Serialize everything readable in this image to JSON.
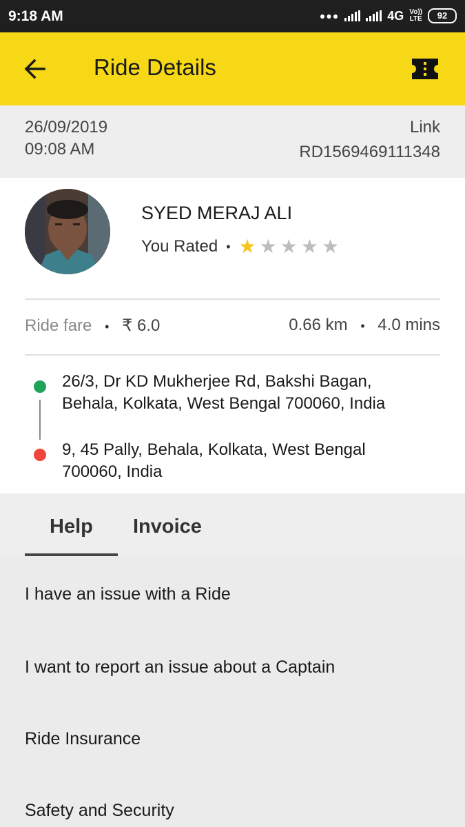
{
  "status_bar": {
    "time": "9:18 AM",
    "network": "4G",
    "volte_line1": "Vo))",
    "volte_line2": "LTE",
    "battery": "92"
  },
  "app_bar": {
    "title": "Ride Details",
    "back_icon": "arrow-left-icon",
    "action_icon": "ticket-icon",
    "background": "#f6d817"
  },
  "ride_meta": {
    "date": "26/09/2019",
    "time": "09:08 AM",
    "link_label": "Link",
    "ride_id": "RD1569469111348"
  },
  "driver": {
    "name": "SYED MERAJ ALI",
    "rated_label": "You Rated",
    "rating": 1,
    "rating_max": 5
  },
  "fare": {
    "label": "Ride fare",
    "amount": "₹ 6.0",
    "distance": "0.66 km",
    "duration": "4.0 mins"
  },
  "route": {
    "pickup_line1": "26/3, Dr KD Mukherjee Rd, Bakshi Bagan,",
    "pickup_line2": "Behala, Kolkata, West Bengal 700060, India",
    "drop_line1": "9, 45 Pally, Behala, Kolkata, West Bengal",
    "drop_line2": "700060, India",
    "pickup_color": "#21a259",
    "drop_color": "#f2453b"
  },
  "tabs": [
    {
      "label": "Help",
      "active": true
    },
    {
      "label": "Invoice",
      "active": false
    }
  ],
  "help_items": [
    "I have an issue with a Ride",
    "I want to report an issue about a Captain",
    "Ride Insurance",
    "Safety and Security"
  ]
}
